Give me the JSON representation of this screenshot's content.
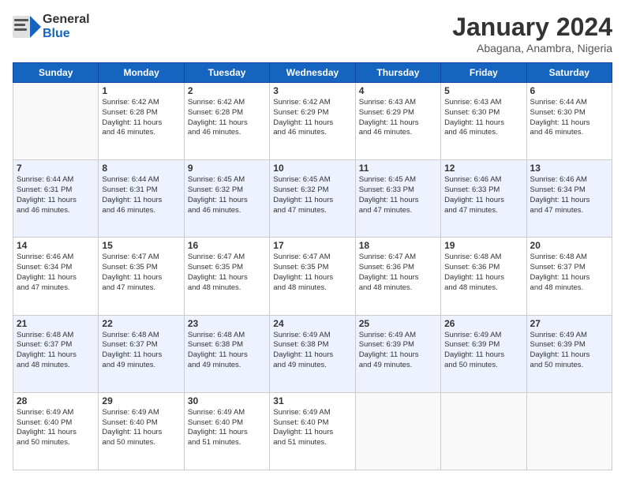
{
  "header": {
    "logo_general": "General",
    "logo_blue": "Blue",
    "month": "January 2024",
    "location": "Abagana, Anambra, Nigeria"
  },
  "days_of_week": [
    "Sunday",
    "Monday",
    "Tuesday",
    "Wednesday",
    "Thursday",
    "Friday",
    "Saturday"
  ],
  "weeks": [
    [
      {
        "day": "",
        "sunrise": "",
        "sunset": "",
        "daylight": ""
      },
      {
        "day": "1",
        "sunrise": "Sunrise: 6:42 AM",
        "sunset": "Sunset: 6:28 PM",
        "daylight": "Daylight: 11 hours and 46 minutes."
      },
      {
        "day": "2",
        "sunrise": "Sunrise: 6:42 AM",
        "sunset": "Sunset: 6:28 PM",
        "daylight": "Daylight: 11 hours and 46 minutes."
      },
      {
        "day": "3",
        "sunrise": "Sunrise: 6:42 AM",
        "sunset": "Sunset: 6:29 PM",
        "daylight": "Daylight: 11 hours and 46 minutes."
      },
      {
        "day": "4",
        "sunrise": "Sunrise: 6:43 AM",
        "sunset": "Sunset: 6:29 PM",
        "daylight": "Daylight: 11 hours and 46 minutes."
      },
      {
        "day": "5",
        "sunrise": "Sunrise: 6:43 AM",
        "sunset": "Sunset: 6:30 PM",
        "daylight": "Daylight: 11 hours and 46 minutes."
      },
      {
        "day": "6",
        "sunrise": "Sunrise: 6:44 AM",
        "sunset": "Sunset: 6:30 PM",
        "daylight": "Daylight: 11 hours and 46 minutes."
      }
    ],
    [
      {
        "day": "7",
        "sunrise": "Sunrise: 6:44 AM",
        "sunset": "Sunset: 6:31 PM",
        "daylight": "Daylight: 11 hours and 46 minutes."
      },
      {
        "day": "8",
        "sunrise": "Sunrise: 6:44 AM",
        "sunset": "Sunset: 6:31 PM",
        "daylight": "Daylight: 11 hours and 46 minutes."
      },
      {
        "day": "9",
        "sunrise": "Sunrise: 6:45 AM",
        "sunset": "Sunset: 6:32 PM",
        "daylight": "Daylight: 11 hours and 46 minutes."
      },
      {
        "day": "10",
        "sunrise": "Sunrise: 6:45 AM",
        "sunset": "Sunset: 6:32 PM",
        "daylight": "Daylight: 11 hours and 47 minutes."
      },
      {
        "day": "11",
        "sunrise": "Sunrise: 6:45 AM",
        "sunset": "Sunset: 6:33 PM",
        "daylight": "Daylight: 11 hours and 47 minutes."
      },
      {
        "day": "12",
        "sunrise": "Sunrise: 6:46 AM",
        "sunset": "Sunset: 6:33 PM",
        "daylight": "Daylight: 11 hours and 47 minutes."
      },
      {
        "day": "13",
        "sunrise": "Sunrise: 6:46 AM",
        "sunset": "Sunset: 6:34 PM",
        "daylight": "Daylight: 11 hours and 47 minutes."
      }
    ],
    [
      {
        "day": "14",
        "sunrise": "Sunrise: 6:46 AM",
        "sunset": "Sunset: 6:34 PM",
        "daylight": "Daylight: 11 hours and 47 minutes."
      },
      {
        "day": "15",
        "sunrise": "Sunrise: 6:47 AM",
        "sunset": "Sunset: 6:35 PM",
        "daylight": "Daylight: 11 hours and 47 minutes."
      },
      {
        "day": "16",
        "sunrise": "Sunrise: 6:47 AM",
        "sunset": "Sunset: 6:35 PM",
        "daylight": "Daylight: 11 hours and 48 minutes."
      },
      {
        "day": "17",
        "sunrise": "Sunrise: 6:47 AM",
        "sunset": "Sunset: 6:35 PM",
        "daylight": "Daylight: 11 hours and 48 minutes."
      },
      {
        "day": "18",
        "sunrise": "Sunrise: 6:47 AM",
        "sunset": "Sunset: 6:36 PM",
        "daylight": "Daylight: 11 hours and 48 minutes."
      },
      {
        "day": "19",
        "sunrise": "Sunrise: 6:48 AM",
        "sunset": "Sunset: 6:36 PM",
        "daylight": "Daylight: 11 hours and 48 minutes."
      },
      {
        "day": "20",
        "sunrise": "Sunrise: 6:48 AM",
        "sunset": "Sunset: 6:37 PM",
        "daylight": "Daylight: 11 hours and 48 minutes."
      }
    ],
    [
      {
        "day": "21",
        "sunrise": "Sunrise: 6:48 AM",
        "sunset": "Sunset: 6:37 PM",
        "daylight": "Daylight: 11 hours and 48 minutes."
      },
      {
        "day": "22",
        "sunrise": "Sunrise: 6:48 AM",
        "sunset": "Sunset: 6:37 PM",
        "daylight": "Daylight: 11 hours and 49 minutes."
      },
      {
        "day": "23",
        "sunrise": "Sunrise: 6:48 AM",
        "sunset": "Sunset: 6:38 PM",
        "daylight": "Daylight: 11 hours and 49 minutes."
      },
      {
        "day": "24",
        "sunrise": "Sunrise: 6:49 AM",
        "sunset": "Sunset: 6:38 PM",
        "daylight": "Daylight: 11 hours and 49 minutes."
      },
      {
        "day": "25",
        "sunrise": "Sunrise: 6:49 AM",
        "sunset": "Sunset: 6:39 PM",
        "daylight": "Daylight: 11 hours and 49 minutes."
      },
      {
        "day": "26",
        "sunrise": "Sunrise: 6:49 AM",
        "sunset": "Sunset: 6:39 PM",
        "daylight": "Daylight: 11 hours and 50 minutes."
      },
      {
        "day": "27",
        "sunrise": "Sunrise: 6:49 AM",
        "sunset": "Sunset: 6:39 PM",
        "daylight": "Daylight: 11 hours and 50 minutes."
      }
    ],
    [
      {
        "day": "28",
        "sunrise": "Sunrise: 6:49 AM",
        "sunset": "Sunset: 6:40 PM",
        "daylight": "Daylight: 11 hours and 50 minutes."
      },
      {
        "day": "29",
        "sunrise": "Sunrise: 6:49 AM",
        "sunset": "Sunset: 6:40 PM",
        "daylight": "Daylight: 11 hours and 50 minutes."
      },
      {
        "day": "30",
        "sunrise": "Sunrise: 6:49 AM",
        "sunset": "Sunset: 6:40 PM",
        "daylight": "Daylight: 11 hours and 51 minutes."
      },
      {
        "day": "31",
        "sunrise": "Sunrise: 6:49 AM",
        "sunset": "Sunset: 6:40 PM",
        "daylight": "Daylight: 11 hours and 51 minutes."
      },
      {
        "day": "",
        "sunrise": "",
        "sunset": "",
        "daylight": ""
      },
      {
        "day": "",
        "sunrise": "",
        "sunset": "",
        "daylight": ""
      },
      {
        "day": "",
        "sunrise": "",
        "sunset": "",
        "daylight": ""
      }
    ]
  ]
}
